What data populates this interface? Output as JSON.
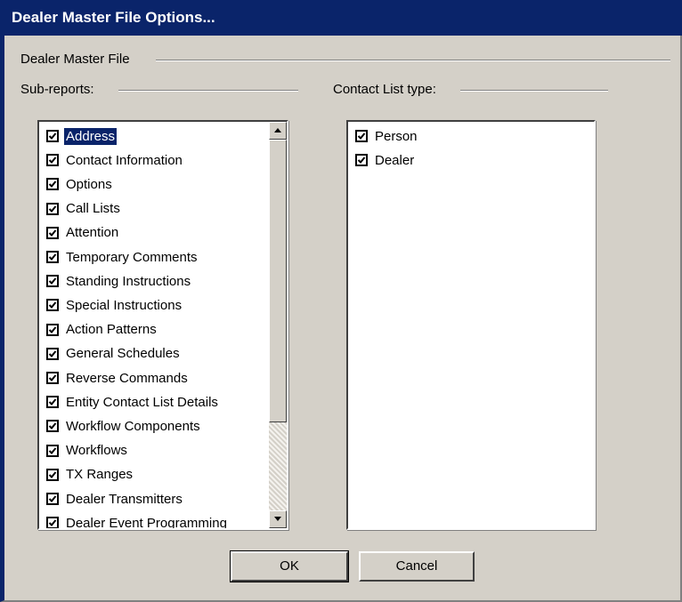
{
  "window": {
    "title": "Dealer Master File Options..."
  },
  "groups": {
    "main_label": "Dealer Master File",
    "subreports_label": "Sub-reports:",
    "contact_label": "Contact List type:"
  },
  "subreports": [
    {
      "label": "Address",
      "checked": true,
      "selected": true
    },
    {
      "label": "Contact Information",
      "checked": true
    },
    {
      "label": "Options",
      "checked": true
    },
    {
      "label": "Call Lists",
      "checked": true
    },
    {
      "label": "Attention",
      "checked": true
    },
    {
      "label": "Temporary Comments",
      "checked": true
    },
    {
      "label": "Standing Instructions",
      "checked": true
    },
    {
      "label": "Special Instructions",
      "checked": true
    },
    {
      "label": "Action Patterns",
      "checked": true
    },
    {
      "label": "General Schedules",
      "checked": true
    },
    {
      "label": "Reverse Commands",
      "checked": true
    },
    {
      "label": "Entity Contact List Details",
      "checked": true
    },
    {
      "label": "Workflow Components",
      "checked": true
    },
    {
      "label": "Workflows",
      "checked": true
    },
    {
      "label": "TX Ranges",
      "checked": true
    },
    {
      "label": "Dealer Transmitters",
      "checked": true
    },
    {
      "label": "Dealer Event Programming",
      "checked": true
    }
  ],
  "contact_types": [
    {
      "label": "Person",
      "checked": true
    },
    {
      "label": "Dealer",
      "checked": true
    }
  ],
  "buttons": {
    "ok": "OK",
    "cancel": "Cancel"
  },
  "colors": {
    "titlebar": "#0a246a",
    "face": "#d4d0c8",
    "selection": "#0a246a"
  }
}
